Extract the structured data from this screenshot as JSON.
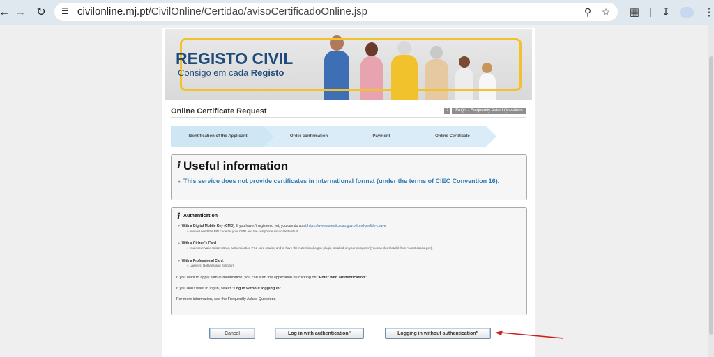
{
  "browser": {
    "url_domain": "civilonline.mj.pt",
    "url_path": "/CivilOnline/Certidao/avisoCertificadoOnline.jsp",
    "back_icon": "arrow-left-icon",
    "forward_icon": "arrow-right-icon",
    "reload_icon": "reload-icon",
    "site_info_icon": "tune-icon",
    "zoom_icon": "zoom-icon",
    "bookmark_icon": "star-icon",
    "extensions_icon": "puzzle-icon",
    "download_icon": "download-icon",
    "menu_icon": "kebab-menu-icon"
  },
  "banner": {
    "title": "REGISTO CIVIL",
    "subtitle_prefix": "Consigo em cada ",
    "subtitle_bold": "Registo",
    "colors": {
      "title": "#1f4b7a",
      "frame": "#f2c22c"
    }
  },
  "header": {
    "title": "Online Certificate Request",
    "faq_icon_text": "?",
    "faq_label": "FAQ's - Frequently Asked Questions"
  },
  "steps": [
    {
      "label": "Identification of the Applicant"
    },
    {
      "label": "Order confirmation"
    },
    {
      "label": "Payment"
    },
    {
      "label": "Online Certificate"
    }
  ],
  "useful_info": {
    "icon": "i",
    "heading": "Useful information",
    "bullet": "»",
    "message": "This service does not provide certificates in international format (under the terms of CIEC Convention 16).",
    "message_color": "#2e7db5"
  },
  "auth": {
    "icon": "i",
    "heading": "Authentication",
    "items": [
      {
        "bullet": "»",
        "bold": "With a Digital Mobile Key (CMD)",
        "text": ": If you haven't registered yet, you can do so at ",
        "link": "https://www.autenticacao.gov.pt/cmd-pedido-chave",
        "sub": "You will need the PIN code for your CMD and the cell phone associated with it."
      },
      {
        "bullet": "»",
        "bold": "With a Citizen's Card",
        "text": ".",
        "link": "",
        "sub": "You need: Valid Citizen Card, authentication PIN, card reader, and to have the Autenticação.gov plugin installed on your computer (you can download it from Autenticacao.gov)."
      },
      {
        "bullet": "»",
        "bold": "With a Professional Card",
        "text": ".",
        "link": "",
        "sub": "Lawyers, Notaries and Solicitors"
      }
    ],
    "para1_prefix": "If you want to apply with authentication, you can start the application by clicking on ",
    "para1_bold": "\"Enter with authentication\"",
    "para1_suffix": ".",
    "para2_prefix": "If you don't want to log in, select ",
    "para2_bold": "\"Log in without logging in\"",
    "para2_suffix": ".",
    "para3": "For more information, see the Frequently Asked Questions"
  },
  "buttons": {
    "cancel": "Cancel",
    "login_auth": "Log in with authentication\"",
    "login_no_auth": "Logging in without authentication\""
  },
  "annotation": {
    "color": "#d11f1f"
  }
}
